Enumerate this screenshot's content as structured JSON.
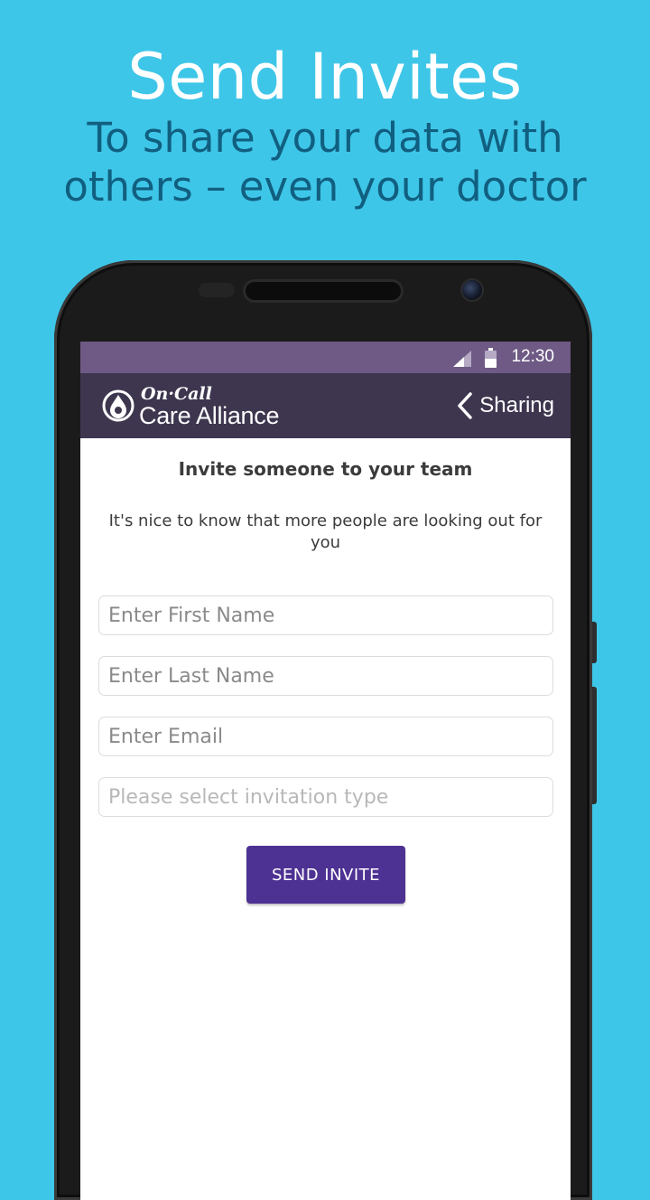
{
  "promo": {
    "title": "Send Invites",
    "subtitle": "To share your data with others – even your doctor"
  },
  "status_bar": {
    "time": "12:30",
    "icons": [
      "signal-icon",
      "battery-icon"
    ]
  },
  "app_bar": {
    "logo_top": "On·Call",
    "logo_bottom": "Care Alliance",
    "back_label": "Sharing",
    "back_icon": "chevron-left-icon"
  },
  "invite": {
    "heading": "Invite someone to your team",
    "description": "It's nice to know that more people are looking out for you",
    "first_name_placeholder": "Enter First Name",
    "last_name_placeholder": "Enter Last Name",
    "email_placeholder": "Enter Email",
    "type_placeholder": "Please select invitation type",
    "send_label": "SEND INVITE"
  },
  "colors": {
    "background": "#3ec6e8",
    "subtitle": "#115f80",
    "status_bar": "#6e5a85",
    "app_bar": "#3e364f",
    "button": "#4e3293"
  }
}
